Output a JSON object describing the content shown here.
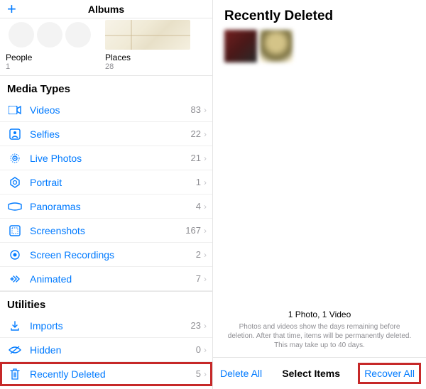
{
  "left": {
    "header": {
      "title": "Albums"
    },
    "albums": [
      {
        "name": "People",
        "count": "1"
      },
      {
        "name": "Places",
        "count": "28"
      }
    ],
    "media_types": {
      "header": "Media Types",
      "items": [
        {
          "icon": "video",
          "label": "Videos",
          "count": "83"
        },
        {
          "icon": "selfie",
          "label": "Selfies",
          "count": "22"
        },
        {
          "icon": "livephoto",
          "label": "Live Photos",
          "count": "21"
        },
        {
          "icon": "portrait",
          "label": "Portrait",
          "count": "1"
        },
        {
          "icon": "panorama",
          "label": "Panoramas",
          "count": "4"
        },
        {
          "icon": "screenshot",
          "label": "Screenshots",
          "count": "167"
        },
        {
          "icon": "screenrec",
          "label": "Screen Recordings",
          "count": "2"
        },
        {
          "icon": "animated",
          "label": "Animated",
          "count": "7"
        }
      ]
    },
    "utilities": {
      "header": "Utilities",
      "items": [
        {
          "icon": "import",
          "label": "Imports",
          "count": "23"
        },
        {
          "icon": "hidden",
          "label": "Hidden",
          "count": "0"
        },
        {
          "icon": "trash",
          "label": "Recently Deleted",
          "count": "5"
        }
      ]
    }
  },
  "right": {
    "title": "Recently Deleted",
    "info_title": "1 Photo, 1 Video",
    "info_text": "Photos and videos show the days remaining before deletion. After that time, items will be permanently deleted. This may take up to 40 days.",
    "toolbar": {
      "delete": "Delete All",
      "select": "Select Items",
      "recover": "Recover All"
    }
  }
}
